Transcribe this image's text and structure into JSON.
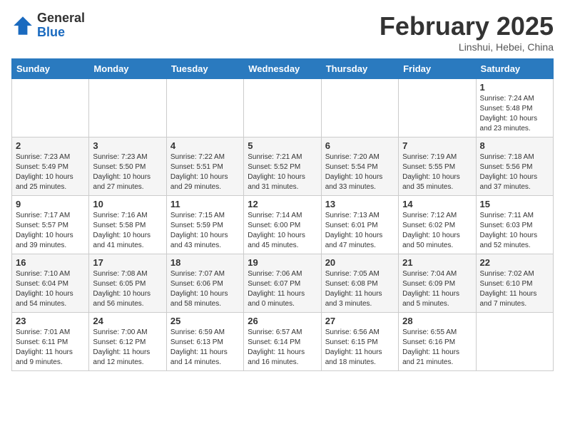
{
  "header": {
    "logo_general": "General",
    "logo_blue": "Blue",
    "month_title": "February 2025",
    "location": "Linshui, Hebei, China"
  },
  "days_of_week": [
    "Sunday",
    "Monday",
    "Tuesday",
    "Wednesday",
    "Thursday",
    "Friday",
    "Saturday"
  ],
  "weeks": [
    [
      {
        "day": "",
        "info": ""
      },
      {
        "day": "",
        "info": ""
      },
      {
        "day": "",
        "info": ""
      },
      {
        "day": "",
        "info": ""
      },
      {
        "day": "",
        "info": ""
      },
      {
        "day": "",
        "info": ""
      },
      {
        "day": "1",
        "info": "Sunrise: 7:24 AM\nSunset: 5:48 PM\nDaylight: 10 hours and 23 minutes."
      }
    ],
    [
      {
        "day": "2",
        "info": "Sunrise: 7:23 AM\nSunset: 5:49 PM\nDaylight: 10 hours and 25 minutes."
      },
      {
        "day": "3",
        "info": "Sunrise: 7:23 AM\nSunset: 5:50 PM\nDaylight: 10 hours and 27 minutes."
      },
      {
        "day": "4",
        "info": "Sunrise: 7:22 AM\nSunset: 5:51 PM\nDaylight: 10 hours and 29 minutes."
      },
      {
        "day": "5",
        "info": "Sunrise: 7:21 AM\nSunset: 5:52 PM\nDaylight: 10 hours and 31 minutes."
      },
      {
        "day": "6",
        "info": "Sunrise: 7:20 AM\nSunset: 5:54 PM\nDaylight: 10 hours and 33 minutes."
      },
      {
        "day": "7",
        "info": "Sunrise: 7:19 AM\nSunset: 5:55 PM\nDaylight: 10 hours and 35 minutes."
      },
      {
        "day": "8",
        "info": "Sunrise: 7:18 AM\nSunset: 5:56 PM\nDaylight: 10 hours and 37 minutes."
      }
    ],
    [
      {
        "day": "9",
        "info": "Sunrise: 7:17 AM\nSunset: 5:57 PM\nDaylight: 10 hours and 39 minutes."
      },
      {
        "day": "10",
        "info": "Sunrise: 7:16 AM\nSunset: 5:58 PM\nDaylight: 10 hours and 41 minutes."
      },
      {
        "day": "11",
        "info": "Sunrise: 7:15 AM\nSunset: 5:59 PM\nDaylight: 10 hours and 43 minutes."
      },
      {
        "day": "12",
        "info": "Sunrise: 7:14 AM\nSunset: 6:00 PM\nDaylight: 10 hours and 45 minutes."
      },
      {
        "day": "13",
        "info": "Sunrise: 7:13 AM\nSunset: 6:01 PM\nDaylight: 10 hours and 47 minutes."
      },
      {
        "day": "14",
        "info": "Sunrise: 7:12 AM\nSunset: 6:02 PM\nDaylight: 10 hours and 50 minutes."
      },
      {
        "day": "15",
        "info": "Sunrise: 7:11 AM\nSunset: 6:03 PM\nDaylight: 10 hours and 52 minutes."
      }
    ],
    [
      {
        "day": "16",
        "info": "Sunrise: 7:10 AM\nSunset: 6:04 PM\nDaylight: 10 hours and 54 minutes."
      },
      {
        "day": "17",
        "info": "Sunrise: 7:08 AM\nSunset: 6:05 PM\nDaylight: 10 hours and 56 minutes."
      },
      {
        "day": "18",
        "info": "Sunrise: 7:07 AM\nSunset: 6:06 PM\nDaylight: 10 hours and 58 minutes."
      },
      {
        "day": "19",
        "info": "Sunrise: 7:06 AM\nSunset: 6:07 PM\nDaylight: 11 hours and 0 minutes."
      },
      {
        "day": "20",
        "info": "Sunrise: 7:05 AM\nSunset: 6:08 PM\nDaylight: 11 hours and 3 minutes."
      },
      {
        "day": "21",
        "info": "Sunrise: 7:04 AM\nSunset: 6:09 PM\nDaylight: 11 hours and 5 minutes."
      },
      {
        "day": "22",
        "info": "Sunrise: 7:02 AM\nSunset: 6:10 PM\nDaylight: 11 hours and 7 minutes."
      }
    ],
    [
      {
        "day": "23",
        "info": "Sunrise: 7:01 AM\nSunset: 6:11 PM\nDaylight: 11 hours and 9 minutes."
      },
      {
        "day": "24",
        "info": "Sunrise: 7:00 AM\nSunset: 6:12 PM\nDaylight: 11 hours and 12 minutes."
      },
      {
        "day": "25",
        "info": "Sunrise: 6:59 AM\nSunset: 6:13 PM\nDaylight: 11 hours and 14 minutes."
      },
      {
        "day": "26",
        "info": "Sunrise: 6:57 AM\nSunset: 6:14 PM\nDaylight: 11 hours and 16 minutes."
      },
      {
        "day": "27",
        "info": "Sunrise: 6:56 AM\nSunset: 6:15 PM\nDaylight: 11 hours and 18 minutes."
      },
      {
        "day": "28",
        "info": "Sunrise: 6:55 AM\nSunset: 6:16 PM\nDaylight: 11 hours and 21 minutes."
      },
      {
        "day": "",
        "info": ""
      }
    ]
  ]
}
